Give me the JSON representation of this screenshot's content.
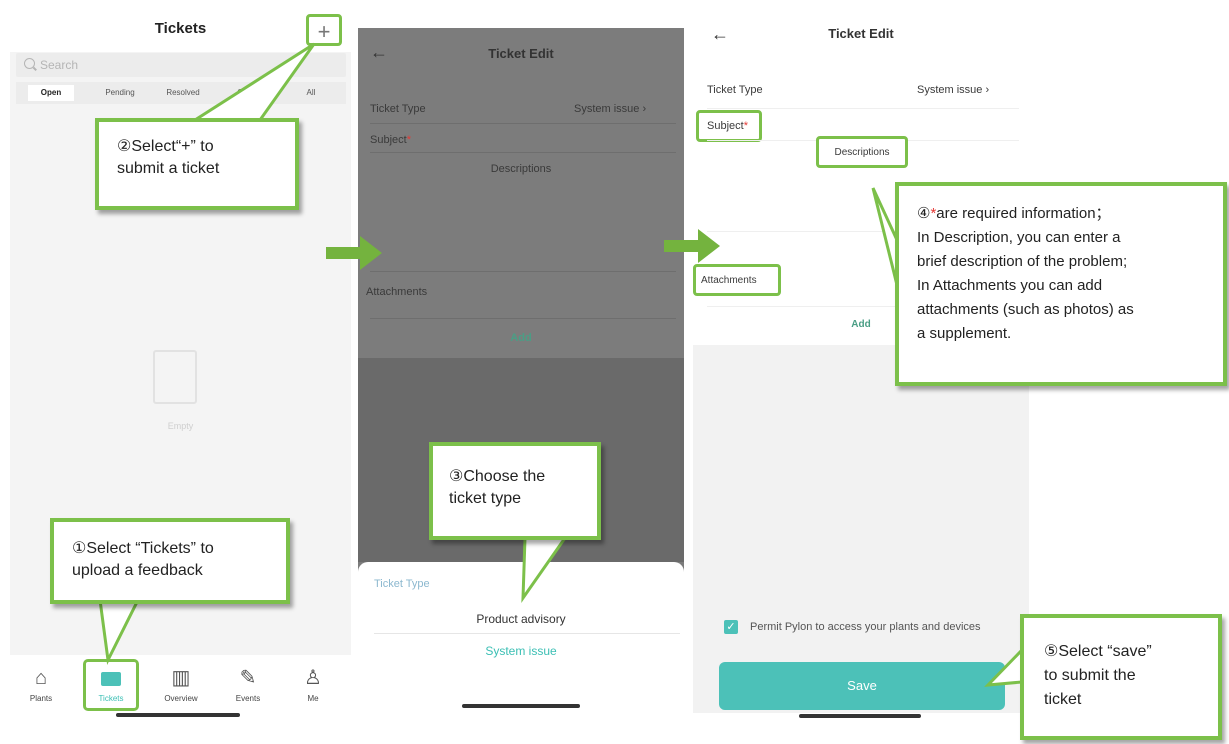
{
  "screen1": {
    "title": "Tickets",
    "add_label": "+",
    "search_placeholder": "Search",
    "tabs": [
      "Open",
      "Pending",
      "Resolved",
      "Cl",
      "All"
    ],
    "empty_text": "Empty",
    "tabbar": [
      {
        "label": "Plants",
        "icon": "home-icon"
      },
      {
        "label": "Tickets",
        "icon": "tickets-icon"
      },
      {
        "label": "Overview",
        "icon": "bar-chart-icon"
      },
      {
        "label": "Events",
        "icon": "wrench-icon"
      },
      {
        "label": "Me",
        "icon": "person-icon"
      }
    ]
  },
  "screen2": {
    "back": "←",
    "title": "Ticket Edit",
    "ticket_type_label": "Ticket Type",
    "ticket_type_value": "System issue",
    "subject_label": "Subject",
    "required_mark": "*",
    "descriptions_label": "Descriptions",
    "attachments_label": "Attachments",
    "add_label": "Add",
    "sheet_title": "Ticket Type",
    "option_1": "Product advisory",
    "option_2": "System issue"
  },
  "screen3": {
    "back": "←",
    "title": "Ticket Edit",
    "ticket_type_label": "Ticket Type",
    "ticket_type_value": "System issue",
    "subject_label": "Subject",
    "required_mark": "*",
    "descriptions_label": "Descriptions",
    "attachments_label": "Attachments",
    "add_label": "Add",
    "permit_text": "Permit Pylon to access your plants and devices",
    "save_label": "Save"
  },
  "callouts": {
    "c1_line1": "①Select “Tickets” to",
    "c1_line2": "upload a feedback",
    "c2_line1": "②Select“+” to",
    "c2_line2": "submit a ticket",
    "c3_line1": "③Choose the",
    "c3_line2": "ticket type",
    "c4_num": "④",
    "c4_star": "*",
    "c4_line1_rest": "are required information；",
    "c4_line2": "In Description, you can enter a",
    "c4_line3": "brief description of the problem;",
    "c4_line4": "In Attachments you can add",
    "c4_line5": "attachments (such as photos) as",
    "c4_line6": "a supplement.",
    "c5_line1": "⑤Select “save”",
    "c5_line2": "to submit the",
    "c5_line3": "ticket"
  },
  "colors": {
    "highlight_green": "#7cc04a",
    "accent_teal": "#4cc1b8",
    "required_red": "#e53935"
  }
}
